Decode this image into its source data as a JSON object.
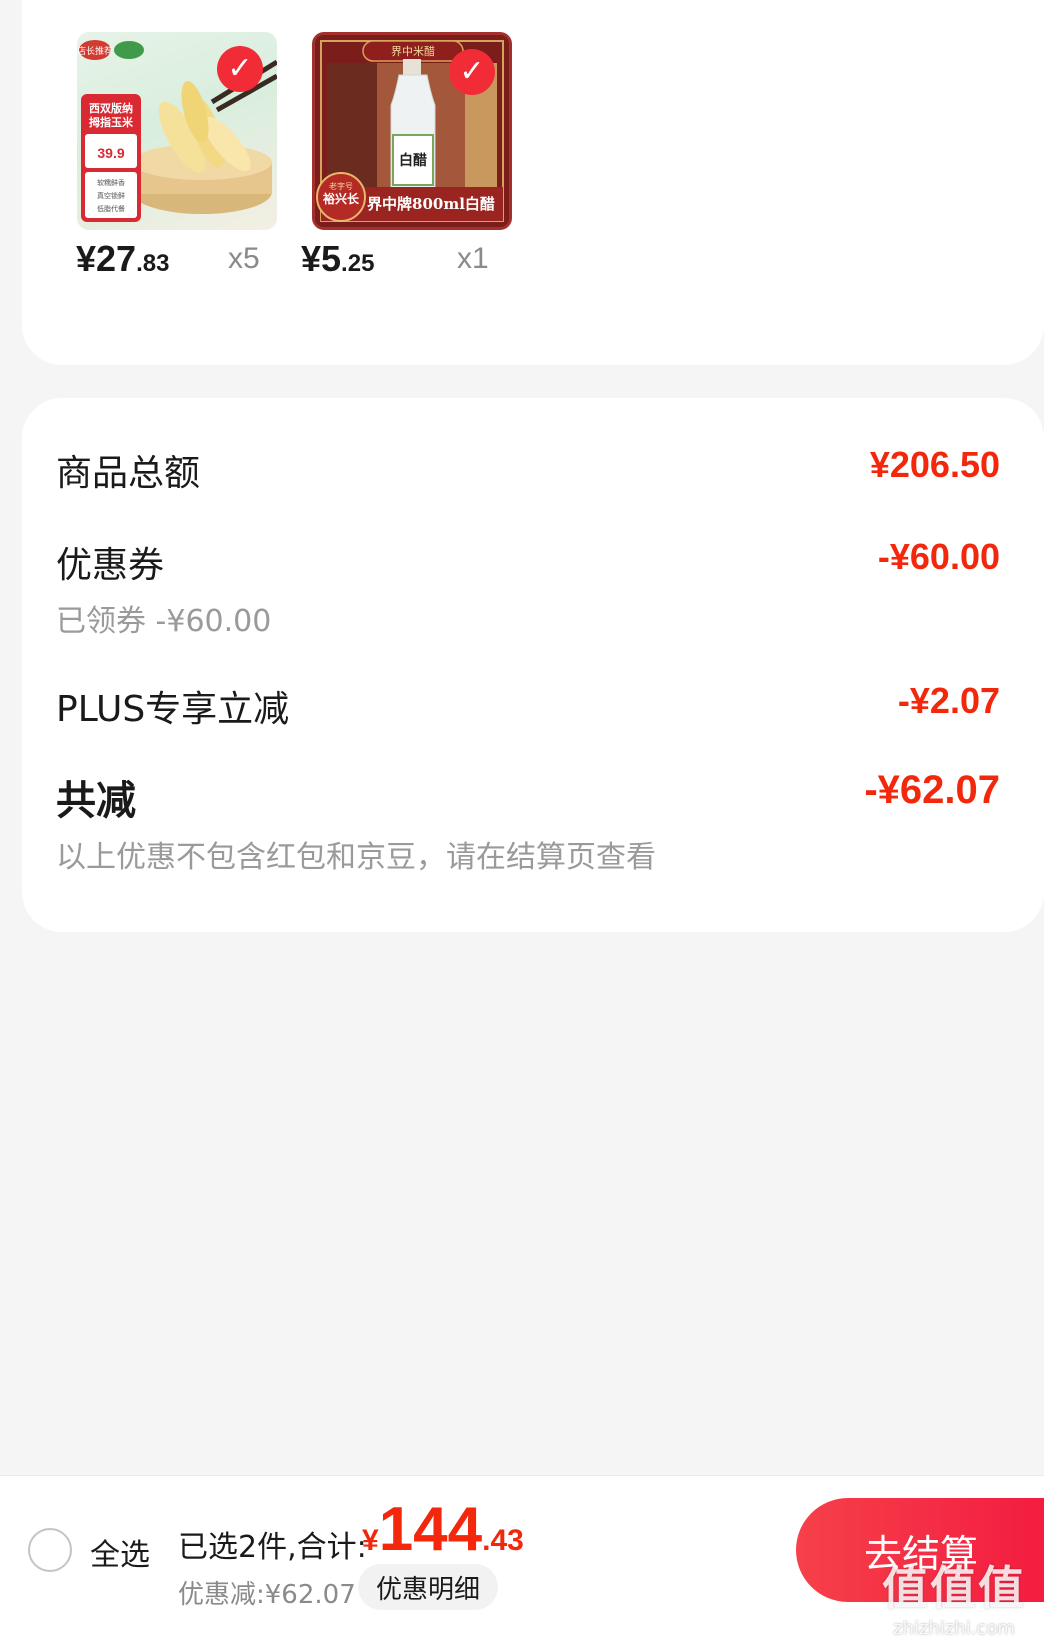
{
  "products": [
    {
      "price_int": "¥27",
      "price_dec": ".83",
      "quantity": "x5",
      "image_icon": "corn-product-image",
      "image_texts": [
        "店长推荐",
        "西双版纳",
        "拇指玉米",
        "39.9",
        "软糯鲜香",
        "真空锁鲜",
        "低脂代餐"
      ],
      "checked": true
    },
    {
      "price_int": "¥5",
      "price_dec": ".25",
      "quantity": "x1",
      "image_icon": "vinegar-product-image",
      "image_texts": [
        "界中米醋",
        "老字号",
        "裕兴长",
        "界中牌800ml白醋"
      ],
      "checked": true
    }
  ],
  "summary": {
    "subtotal_label": "商品总额",
    "subtotal_value": "¥206.50",
    "coupon_label": "优惠券",
    "coupon_value": "-¥60.00",
    "coupon_sub": "已领券 -¥60.00",
    "plus_label": "PLUS专享立减",
    "plus_value": "-¥2.07",
    "total_discount_label": "共减",
    "total_discount_value": "-¥62.07",
    "note": "以上优惠不包含红包和京豆，请在结算页查看"
  },
  "bottom_bar": {
    "select_all_label": "全选",
    "selected_text": "已选2件,合计:",
    "total_symbol": "¥",
    "total_int": "144",
    "total_dec": ".43",
    "discount_text": "优惠减:¥62.07",
    "discount_detail_label": "优惠明细",
    "checkout_label": "去结算"
  },
  "watermark": {
    "main": "值值值",
    "sub": "zhizhizhi.com"
  },
  "colors": {
    "accent_red": "#f2270c",
    "check_red": "#f22c36",
    "checkout_gradient_start": "#f6404a",
    "checkout_gradient_end": "#f2153e",
    "background": "#f5f5f5"
  }
}
